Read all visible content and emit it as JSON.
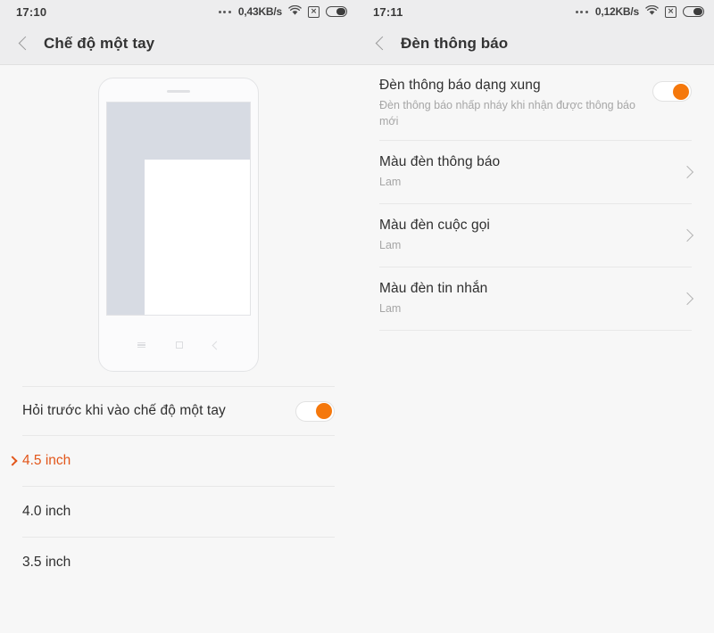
{
  "left_panel": {
    "statusbar": {
      "clock": "17:10",
      "overflow_icon": "more-dots-icon",
      "network_speed": "0,43KB/s",
      "wifi_icon": "wifi-icon",
      "sim_icon": "sim-disabled-icon",
      "sim_glyph": "×",
      "battery_icon": "battery-icon"
    },
    "header": {
      "back_icon": "back-chevron-icon",
      "title": "Chế độ một tay"
    },
    "illustration": {
      "name": "one-handed-mode-phone-preview",
      "nav_menu_icon": "menu-icon",
      "nav_home_icon": "home-square-icon",
      "nav_back_icon": "back-chevron-icon"
    },
    "ask_row": {
      "title": "Hỏi trước khi vào chế độ một tay",
      "toggle_on": true
    },
    "size_options": [
      {
        "label": "4.5 inch",
        "selected": true
      },
      {
        "label": "4.0 inch",
        "selected": false
      },
      {
        "label": "3.5 inch",
        "selected": false
      }
    ]
  },
  "right_panel": {
    "statusbar": {
      "clock": "17:11",
      "overflow_icon": "more-dots-icon",
      "network_speed": "0,12KB/s",
      "wifi_icon": "wifi-icon",
      "sim_icon": "sim-disabled-icon",
      "sim_glyph": "×",
      "battery_icon": "battery-icon"
    },
    "header": {
      "back_icon": "back-chevron-icon",
      "title": "Đèn thông báo"
    },
    "pulse_row": {
      "title": "Đèn thông báo dạng xung",
      "subtitle": "Đèn thông báo nhấp nháy khi nhận được thông báo mới",
      "toggle_on": true
    },
    "color_rows": [
      {
        "title": "Màu đèn thông báo",
        "value": "Lam"
      },
      {
        "title": "Màu đèn cuộc gọi",
        "value": "Lam"
      },
      {
        "title": "Màu đèn tin nhắn",
        "value": "Lam"
      }
    ]
  },
  "colors": {
    "accent": "#f5780c",
    "selected_text": "#e2561a",
    "header_bg": "#ededee",
    "body_bg": "#f7f7f7",
    "screen_grey": "#d7dbe3"
  }
}
